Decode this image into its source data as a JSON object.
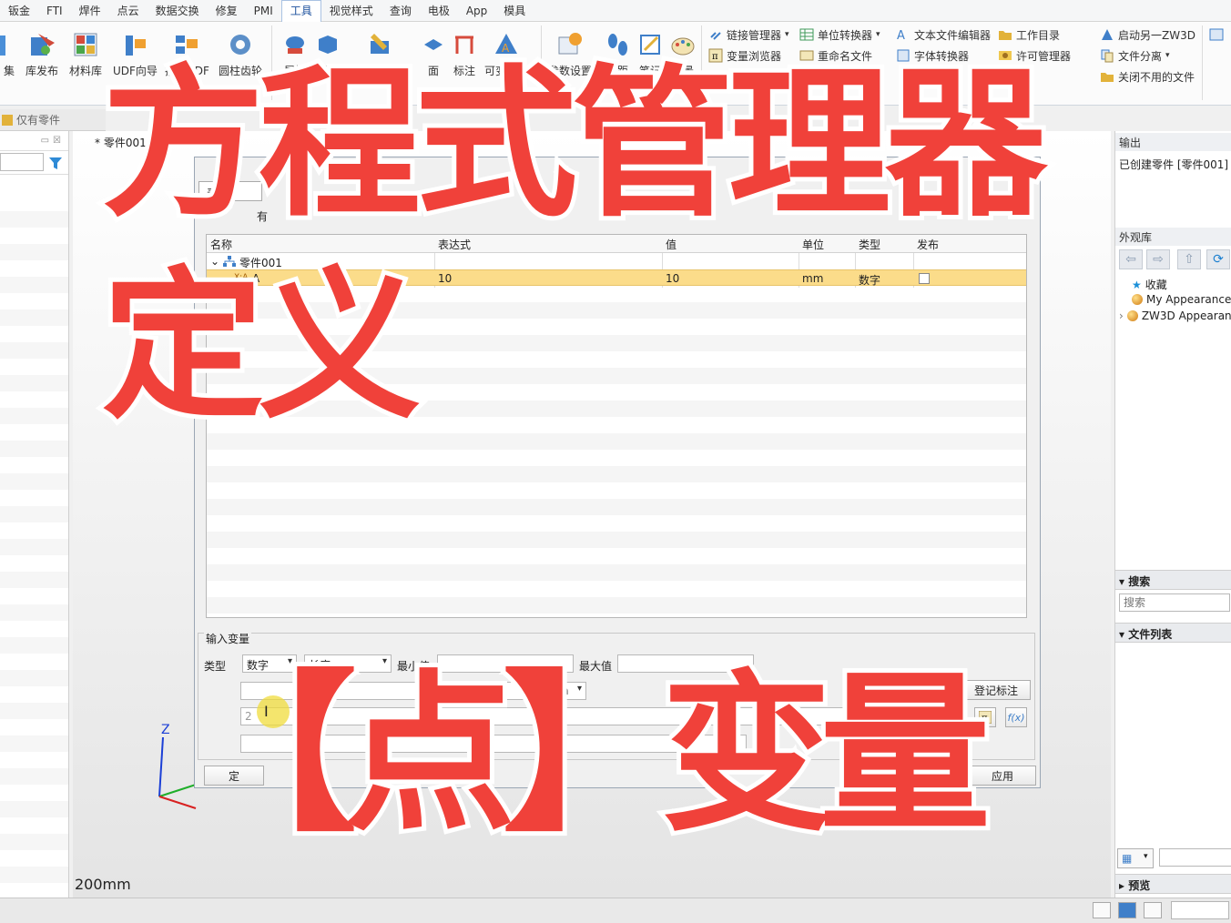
{
  "menu": {
    "items": [
      "钣金",
      "FTI",
      "焊件",
      "点云",
      "数据交换",
      "修复",
      "PMI",
      "工具",
      "视觉样式",
      "查询",
      "电极",
      "App",
      "模具"
    ],
    "active": "工具"
  },
  "ribbon": {
    "cut_label": "集",
    "big_buttons": [
      "库发布",
      "材料库",
      "UDF向导",
      "插入UDF",
      "圆柱齿轮",
      "属性",
      "钣金",
      "批量编辑属性",
      "面",
      "标注",
      "可变数据",
      "参数设置",
      "步距",
      "笔记",
      "背景"
    ],
    "small_col1": [
      "链接管理器",
      "变量浏览器",
      "…管理"
    ],
    "small_col2": [
      "单位转换器",
      "重命名文件"
    ],
    "small_col3": [
      "文本文件编辑器",
      "字体转换器"
    ],
    "small_col4": [
      "工作目录",
      "许可管理器"
    ],
    "small_col5": [
      "启动另一ZW3D",
      "文件分离",
      "关闭不用的文件"
    ]
  },
  "left_panel": {
    "header": "仅有零件"
  },
  "document": {
    "tab": "* 零件001",
    "scale": "200mm"
  },
  "dialog": {
    "tab_fragment": "表",
    "tab2_fragment": "有",
    "title_fragment": "理器",
    "columns": [
      "名称",
      "表达式",
      "值",
      "单位",
      "类型",
      "发布"
    ],
    "tree_root": "零件001",
    "rows": [
      {
        "name": "A",
        "expression": "10",
        "value": "10",
        "unit": "mm",
        "type": "数字",
        "published": false
      }
    ],
    "group_title": "输入变量",
    "type_label": "类型",
    "type_value": "数字",
    "kind_value": "长度",
    "min_label": "最小值",
    "max_label": "最大值",
    "unit_value": "mm",
    "expr_btn_fragment": "达式",
    "register_btn": "登记标注",
    "cancel_fragment": "消",
    "apply_btn": "应用",
    "input_fragment": "2",
    "ok_fragment": "定"
  },
  "right_panel": {
    "output_title": "输出",
    "output_text": "已创建零件 [零件001]",
    "appearance_title": "外观库",
    "library_items": [
      "收藏",
      "My Appearance",
      "ZW3D Appearanc"
    ],
    "search_title": "搜索",
    "search_placeholder": "搜索",
    "file_list_title": "文件列表",
    "preview_title": "预览"
  },
  "overlay": {
    "line1": "方程式管理器",
    "line2": "定义",
    "line3": "【点】变量"
  },
  "colors": {
    "overlay_red": "#f0413a",
    "selected_row": "#fbdc8a",
    "accent_blue": "#1a4f9c"
  }
}
